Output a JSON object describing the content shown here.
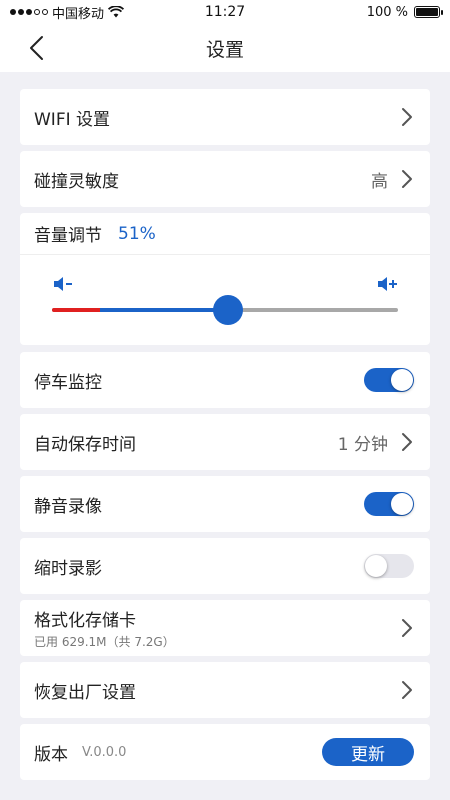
{
  "status_bar": {
    "carrier": "中国移动",
    "time": "11:27",
    "battery": "100 %",
    "battery_level": 1.0
  },
  "nav": {
    "title": "设置",
    "back_icon": "chevron-left-icon"
  },
  "rows": {
    "wifi": {
      "label": "WIFI 设置"
    },
    "collision": {
      "label": "碰撞灵敏度",
      "value": "高"
    },
    "volume": {
      "label": "音量调节",
      "value": "51%",
      "level": 0.51,
      "red_level": 0.14
    },
    "parking": {
      "label": "停车监控",
      "on": true
    },
    "autosave": {
      "label": "自动保存时间",
      "value": "1 分钟"
    },
    "mute": {
      "label": "静音录像",
      "on": true
    },
    "timelapse": {
      "label": "缩时录影",
      "on": false
    },
    "format": {
      "label": "格式化存储卡",
      "sub": "已用 629.1M（共 7.2G）"
    },
    "reset": {
      "label": "恢复出厂设置"
    },
    "version": {
      "label": "版本",
      "value": "V.0.0.0",
      "button": "更新"
    }
  },
  "colors": {
    "accent": "#1b63c8",
    "volume_low": "#e02020",
    "background": "#f0f0f5"
  }
}
